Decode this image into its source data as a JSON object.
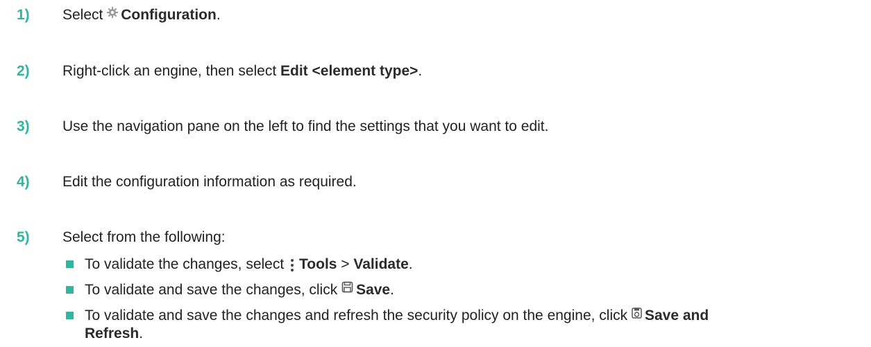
{
  "steps": [
    {
      "num": "1)",
      "pre": "Select ",
      "icon": "gear-icon",
      "bold": "Configuration",
      "post": "."
    },
    {
      "num": "2)",
      "pre": "Right-click an engine, then select ",
      "bold": "Edit <element type>",
      "post": "."
    },
    {
      "num": "3)",
      "text": "Use the navigation pane on the left to find the settings that you want to edit."
    },
    {
      "num": "4)",
      "text": "Edit the configuration information as required."
    },
    {
      "num": "5)",
      "text": "Select from the following:"
    }
  ],
  "bullets": [
    {
      "pre": "To validate the changes, select ",
      "icon": "kebab-menu-icon",
      "bold1": "Tools",
      "sep": " > ",
      "bold2": "Validate",
      "post": "."
    },
    {
      "pre": "To validate and save the changes, click ",
      "icon": "save-icon",
      "bold": "Save",
      "post": "."
    },
    {
      "pre": "To validate and save the changes and refresh the security policy on the engine, click ",
      "icon": "save-refresh-icon",
      "bold": "Save and",
      "bold_cont": "Refresh",
      "post": "."
    }
  ],
  "colors": {
    "accent": "#2fb5a0",
    "text": "#222222"
  }
}
